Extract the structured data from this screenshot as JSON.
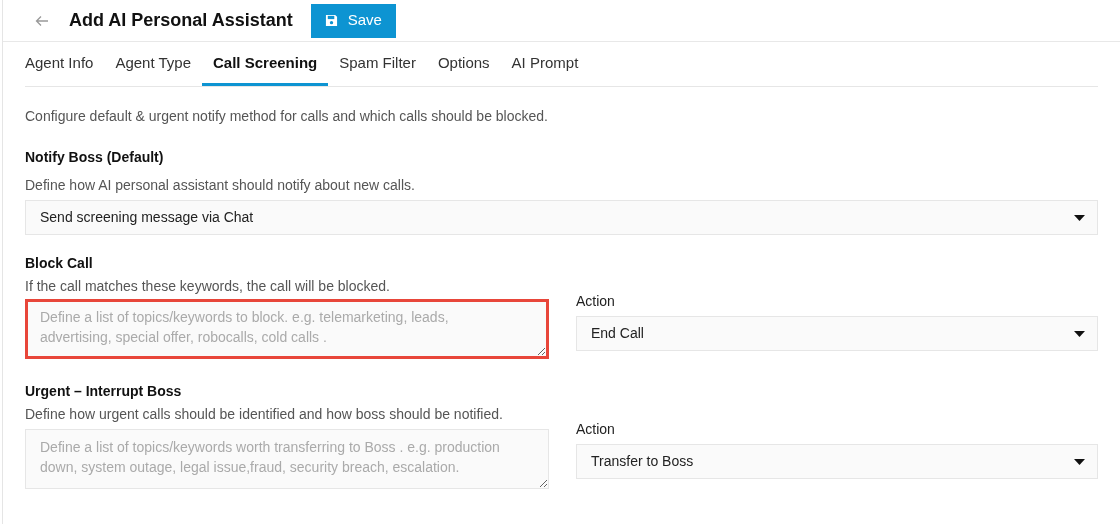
{
  "header": {
    "title": "Add AI Personal Assistant",
    "save_button": "Save"
  },
  "tabs": [
    {
      "label": "Agent Info",
      "selected": false
    },
    {
      "label": "Agent Type",
      "selected": false
    },
    {
      "label": "Call Screening",
      "selected": true
    },
    {
      "label": "Spam Filter",
      "selected": false
    },
    {
      "label": "Options",
      "selected": false
    },
    {
      "label": "AI Prompt",
      "selected": false
    }
  ],
  "intro": "Configure default & urgent notify method for calls and which calls should be blocked.",
  "notify_boss": {
    "heading": "Notify Boss (Default)",
    "description": "Define how AI personal assistant should notify about new calls.",
    "select_value": "Send screening message via Chat"
  },
  "sections": [
    {
      "heading": "Block Call",
      "description": "If the call matches these keywords, the call will be blocked.",
      "placeholder": "Define a list of topics/keywords to block. e.g. telemarketing, leads, advertising, special offer, robocalls, cold calls .",
      "highlighted": true,
      "action_label": "Action",
      "action_value": "End Call"
    },
    {
      "heading": "Urgent – Interrupt Boss",
      "description": "Define how urgent calls should be identified and how boss should be notified.",
      "placeholder": "Define a list of topics/keywords worth transferring to Boss . e.g. production down, system outage, legal issue,fraud, security breach, escalation.",
      "highlighted": false,
      "action_label": "Action",
      "action_value": "Transfer to Boss"
    }
  ]
}
